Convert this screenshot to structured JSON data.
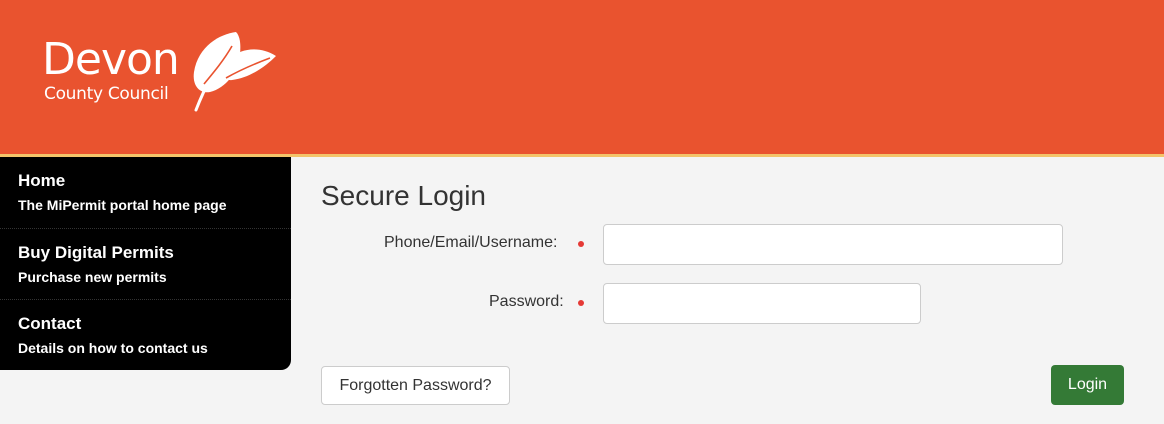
{
  "logo": {
    "line1": "Devon",
    "line2": "County Council",
    "icon": "leaf-icon"
  },
  "nav": [
    {
      "title": "Home",
      "subtitle": "The MiPermit portal home page"
    },
    {
      "title": "Buy Digital Permits",
      "subtitle": "Purchase new permits"
    },
    {
      "title": "Contact",
      "subtitle": "Details on how to contact us"
    }
  ],
  "login": {
    "title": "Secure Login",
    "username_label": "Phone/Email/Username:",
    "username_value": "",
    "password_label": "Password:",
    "password_value": "",
    "forgot_label": "Forgotten Password?",
    "login_label": "Login"
  },
  "colors": {
    "header": "#e9532f",
    "header_rule": "#f3c46a",
    "login_button": "#347a36",
    "required_marker": "#e53935"
  }
}
